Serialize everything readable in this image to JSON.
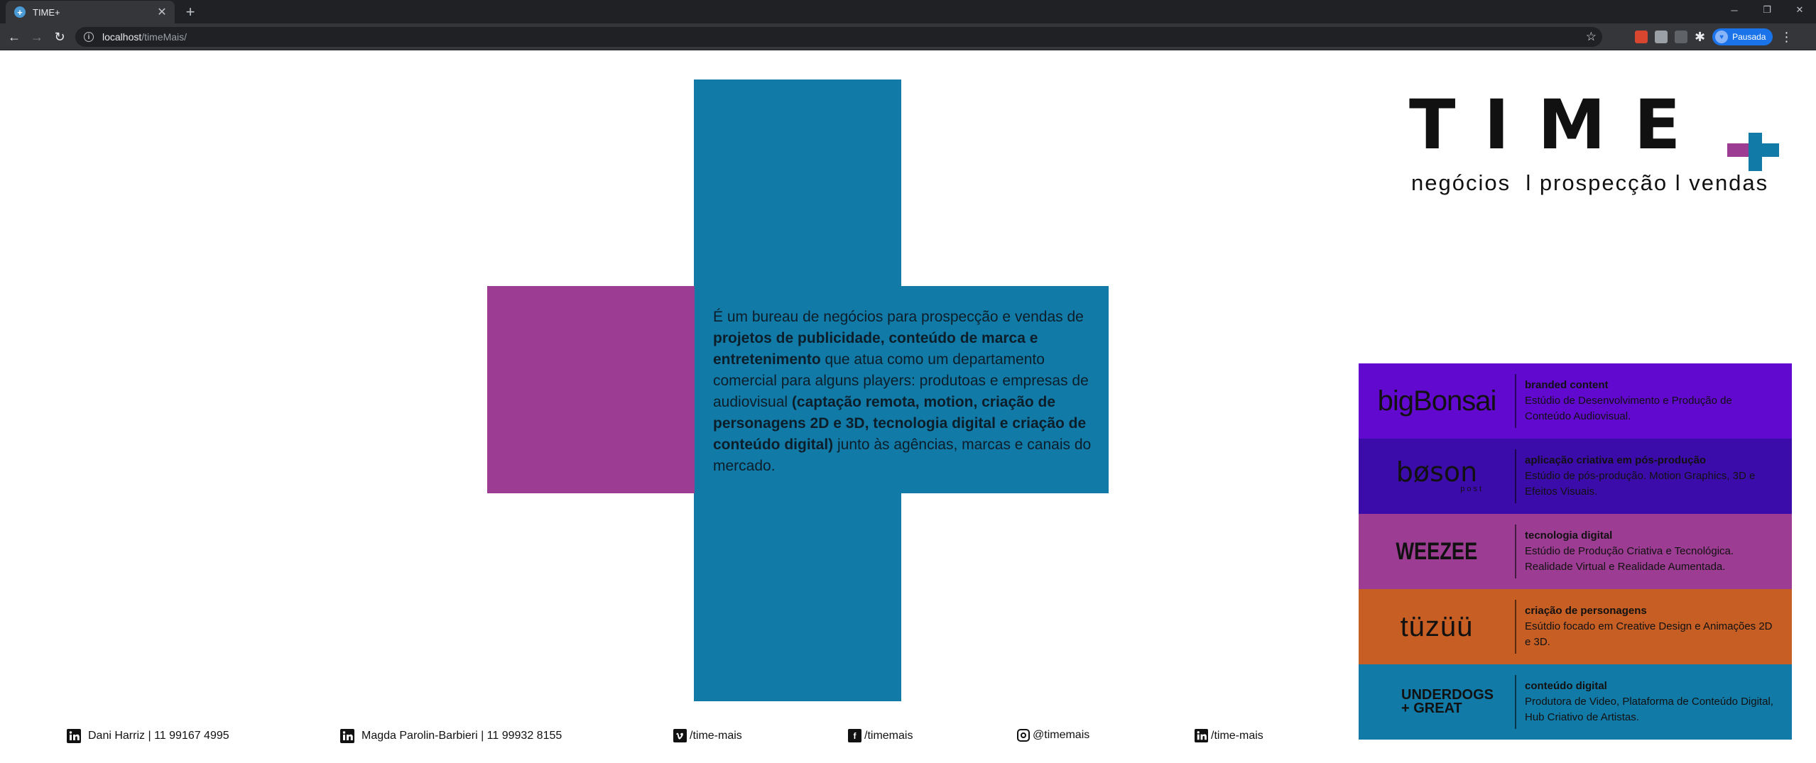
{
  "browser": {
    "tab_title": "TIME+",
    "url_host": "localhost",
    "url_path": "/timeMais/",
    "profile_label": "Pausada"
  },
  "hero": {
    "description_parts": [
      "É um bureau de negócios para prospecção e vendas de ",
      "projetos de publicidade, conteúdo de marca e entretenimento",
      " que atua como um departamento comercial para alguns players: produtoas e empresas de audiovisual ",
      "(captação remota, motion, criação de personagens 2D e 3D, tecnologia digital e criação de conteúdo digital)",
      " junto às agências, marcas e canais do mercado."
    ]
  },
  "brand": {
    "logo_text": "TIME",
    "tagline": "negócios  l prospecção l vendas",
    "colors": {
      "blue": "#127aa7",
      "magenta": "#9c3c92"
    }
  },
  "partners": [
    {
      "name": "bigBonsai",
      "color": "#6109cf",
      "category": "branded content",
      "description": "Estúdio de Desenvolvimento e Produção de Conteúdo Audiovisual."
    },
    {
      "name": "bøson",
      "sub": "post",
      "color": "#3c0caa",
      "category": "aplicação criativa em pós-produção",
      "description": "Estúdio de pós-produção. Motion Graphics, 3D e Efeitos Visuais."
    },
    {
      "name": "WEEZEE",
      "color": "#9c3c92",
      "category": "tecnologia digital",
      "description": "Estúdio de Produção Criativa e Tecnológica. Realidade Virtual e Realidade Aumentada."
    },
    {
      "name": "tüzüü",
      "color": "#c75f24",
      "category": "criação de personagens",
      "description": "Esútdio focado em Creative Design e Animações 2D e 3D."
    },
    {
      "name": "UNDERDOGS + GREAT",
      "line1": "UNDERDOGS",
      "line2": "+ GREAT",
      "color": "#127aa7",
      "category": "conteúdo digital",
      "description": "Produtora de Video, Plataforma de Conteúdo Digital, Hub Criativo de Artistas."
    }
  ],
  "footer": {
    "contact1": "Dani Harriz | 11 99167 4995",
    "contact2": "Magda Parolin-Barbieri | 11 99932 8155",
    "vimeo": "/time-mais",
    "facebook": "/timemais",
    "instagram": "@timemais",
    "linkedin": "/time-mais"
  }
}
